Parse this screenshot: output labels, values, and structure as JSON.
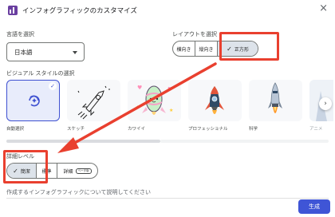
{
  "header": {
    "title": "インフォグラフィックのカスタマイズ",
    "close": "×"
  },
  "language": {
    "label": "言語を選択",
    "value": "日本語"
  },
  "layout": {
    "label": "レイアウトを選択",
    "options": [
      {
        "label": "横向き",
        "active": false
      },
      {
        "label": "縦向き",
        "active": false
      },
      {
        "label": "正方形",
        "active": true
      }
    ]
  },
  "visual_style": {
    "label": "ビジュアル スタイルの選択",
    "cards": [
      {
        "caption": "自動選択",
        "icon": "refresh-sparkle-icon",
        "selected": true
      },
      {
        "caption": "スケッチ",
        "icon": "sketch-rocket-icon",
        "selected": false
      },
      {
        "caption": "カワイイ",
        "icon": "kawaii-rocket-icon",
        "selected": false
      },
      {
        "caption": "プロフェッショナル",
        "icon": "flat-rocket-icon",
        "selected": false
      },
      {
        "caption": "科学",
        "icon": "scientific-rocket-icon",
        "selected": false
      },
      {
        "caption": "アニメ",
        "icon": "anime-icon",
        "selected": false
      }
    ],
    "next": "›"
  },
  "detail_level": {
    "label": "詳細レベル",
    "options": [
      {
        "label": "簡潔",
        "active": true
      },
      {
        "label": "標準",
        "active": false
      },
      {
        "label": "詳細",
        "active": false,
        "badge": "ベータ版"
      }
    ]
  },
  "description": {
    "label": "作成するインフォグラフィックについて説明してください"
  },
  "footer": {
    "generate": "生成"
  },
  "colors": {
    "accent": "#3f55d6",
    "annotation": "#e9402f"
  }
}
